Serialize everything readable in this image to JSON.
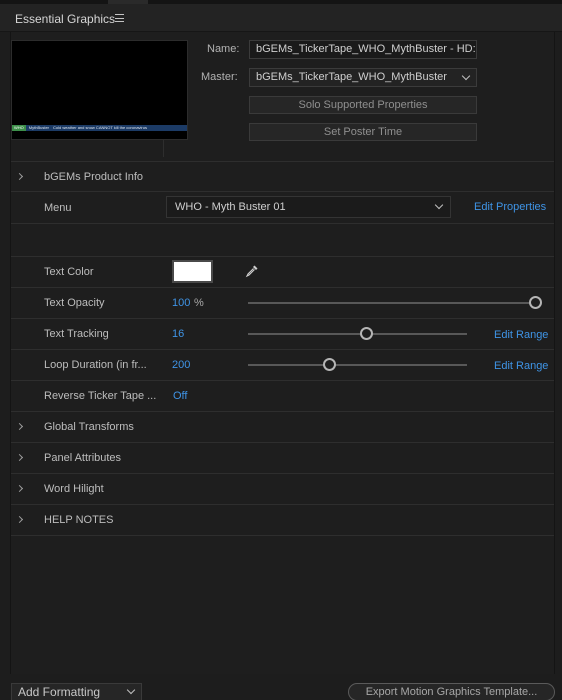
{
  "panel": {
    "title": "Essential Graphics",
    "menu_icon": "hamburger-menu-icon"
  },
  "thumbnail": {
    "segment1": "WHO",
    "segment2": "MythBuster",
    "segment3": "Cold weather and snow CANNOT kill the coronavirus"
  },
  "name": {
    "label": "Name:",
    "value": "bGEMs_TickerTape_WHO_MythBuster - HD:"
  },
  "master": {
    "label": "Master:",
    "value": "bGEMs_TickerTape_WHO_MythBuster"
  },
  "buttons": {
    "solo": "Solo Supported Properties",
    "poster": "Set Poster Time"
  },
  "properties": {
    "product_info": {
      "label": "bGEMs Product Info"
    },
    "menu": {
      "label": "Menu",
      "value": "WHO - Myth Buster 01",
      "link": "Edit Properties"
    },
    "text_color": {
      "label": "Text Color",
      "value": "#ffffff"
    },
    "text_opacity": {
      "label": "Text Opacity",
      "value": "100",
      "unit": "%",
      "fraction": 1.0
    },
    "text_tracking": {
      "label": "Text Tracking",
      "value": "16",
      "link": "Edit Range",
      "fraction": 0.54
    },
    "loop_duration": {
      "label": "Loop Duration (in fr...",
      "value": "200",
      "link": "Edit Range",
      "fraction": 0.37
    },
    "reverse_ticker": {
      "label": "Reverse Ticker Tape ...",
      "value": "Off"
    },
    "groups": [
      {
        "label": "Global Transforms"
      },
      {
        "label": "Panel Attributes"
      },
      {
        "label": "Word Hilight"
      },
      {
        "label": "HELP NOTES"
      }
    ]
  },
  "footer": {
    "add_formatting": "Add Formatting",
    "export": "Export Motion Graphics Template..."
  },
  "colors": {
    "accent": "#3f94e6",
    "background": "#1e1e1e"
  }
}
